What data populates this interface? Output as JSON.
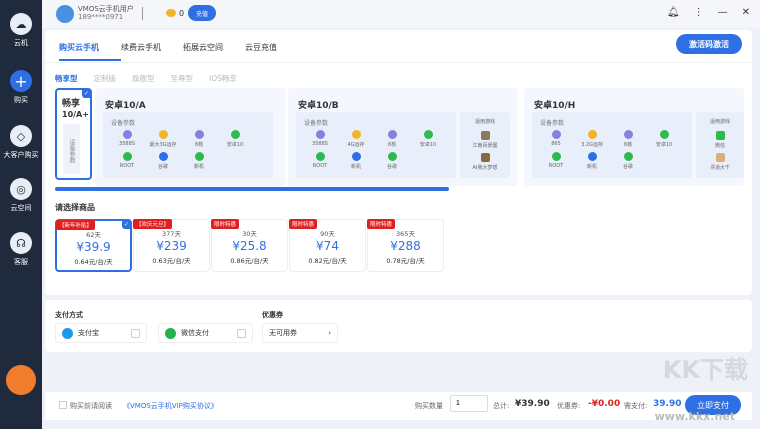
{
  "sidebar": {
    "items": [
      {
        "label": "云机",
        "icon": "cloud-phone-icon"
      },
      {
        "label": "购买",
        "icon": "plus-icon"
      },
      {
        "label": "大客户购买",
        "icon": "diamond-icon"
      },
      {
        "label": "云空间",
        "icon": "cloud-space-icon"
      },
      {
        "label": "客服",
        "icon": "headset-icon"
      }
    ]
  },
  "user": {
    "name": "VMOS云手机用户",
    "phone": "189****0971",
    "coins": "0",
    "recharge": "充值"
  },
  "tabs": [
    "购买云手机",
    "续费云手机",
    "拓展云空间",
    "云豆充值"
  ],
  "activate_label": "激活码激活",
  "types": [
    "畅享型",
    "定制版",
    "旗舰型",
    "至尊型",
    "IOS畅享"
  ],
  "devices": {
    "a_plus": {
      "title": "畅享",
      "subtitle": "10/A+",
      "params": "设备参数"
    },
    "a": {
      "title": "安卓10/A",
      "params_title": "设备参数",
      "params": [
        "3588S",
        "最大3G运存",
        "8核",
        "安卓10",
        "ROOT",
        "谷歌",
        "新机"
      ]
    },
    "b": {
      "title": "安卓10/B",
      "params_title": "设备参数",
      "params": [
        "3588S",
        "4G运存",
        "8核",
        "安卓10",
        "ROOT",
        "新机",
        "谷歌"
      ],
      "games_title": "适用游戏",
      "games": [
        "江南百景图",
        "AI我大梦想"
      ]
    },
    "h": {
      "title": "安卓10/H",
      "params_title": "设备参数",
      "params": [
        "865",
        "3.2G运存",
        "8核",
        "安卓10",
        "ROOT",
        "新机",
        "谷歌"
      ],
      "games_title": "适用游戏",
      "games": [
        "微信",
        "寻道大千"
      ]
    }
  },
  "products_title": "请选择商品",
  "products": [
    {
      "badge": "【新年补贴】",
      "days": "62天",
      "price": "¥39.9",
      "unit": "0.64元/台/天"
    },
    {
      "badge": "【欢庆元旦】",
      "days": "377天",
      "price": "¥239",
      "unit": "0.63元/台/天"
    },
    {
      "badge": "限时特惠",
      "days": "30天",
      "price": "¥25.8",
      "unit": "0.86元/台/天"
    },
    {
      "badge": "限时特惠",
      "days": "90天",
      "price": "¥74",
      "unit": "0.82元/台/天"
    },
    {
      "badge": "限时特惠",
      "days": "365天",
      "price": "¥288",
      "unit": "0.78元/台/天"
    }
  ],
  "payment": {
    "title": "支付方式",
    "alipay": "支付宝",
    "wechat": "微信支付",
    "coupon_title": "优惠券",
    "coupon_value": "无可用券"
  },
  "footer": {
    "agree": "购买前请阅读",
    "agreement": "《VMOS云手机VIP购买协议》",
    "qty_label": "购买数量",
    "qty": "1",
    "total_label": "总计:",
    "total": "¥39.90",
    "discount_label": "优惠券:",
    "discount": "-¥0.00",
    "due_label": "需支付:",
    "due": "39.90",
    "pay": "立即支付"
  },
  "watermark": {
    "text": "KK下载",
    "url": "www.kkx.net"
  }
}
